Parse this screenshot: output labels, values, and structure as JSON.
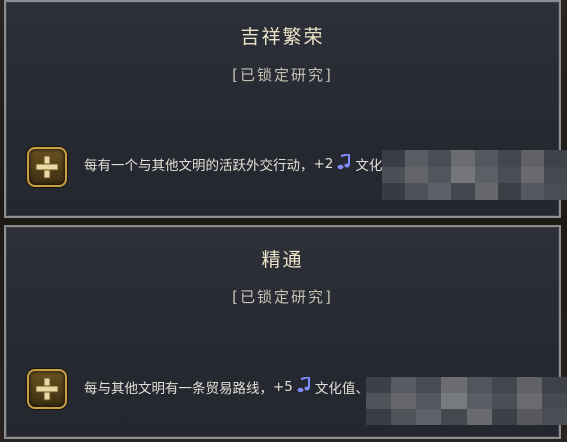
{
  "cards": [
    {
      "title": "吉祥繁荣",
      "status": "[已锁定研究]",
      "effect": {
        "prefix": "每有一个与其他文明的活跃外交行动，",
        "amount1": "+2",
        "icon1": "culture-note-icon",
        "label1": "文化值",
        "suffix": "。"
      }
    },
    {
      "title": "精通",
      "status": "[已锁定研究]",
      "effect": {
        "prefix": "每与其他文明有一条贸易路线，",
        "amount1": "+5",
        "icon1": "culture-note-icon",
        "label1": "文化值、",
        "amount2": "+2",
        "icon2": "gold-coin-icon",
        "label2": "金币",
        "suffix": "。"
      }
    }
  ],
  "colors": {
    "border": "#8c8c93",
    "panel": "#2d3038",
    "title": "#ece4c8",
    "badge_border": "#c7a048",
    "note_blue": "#7f8cff",
    "gold": "#e9c44a"
  }
}
